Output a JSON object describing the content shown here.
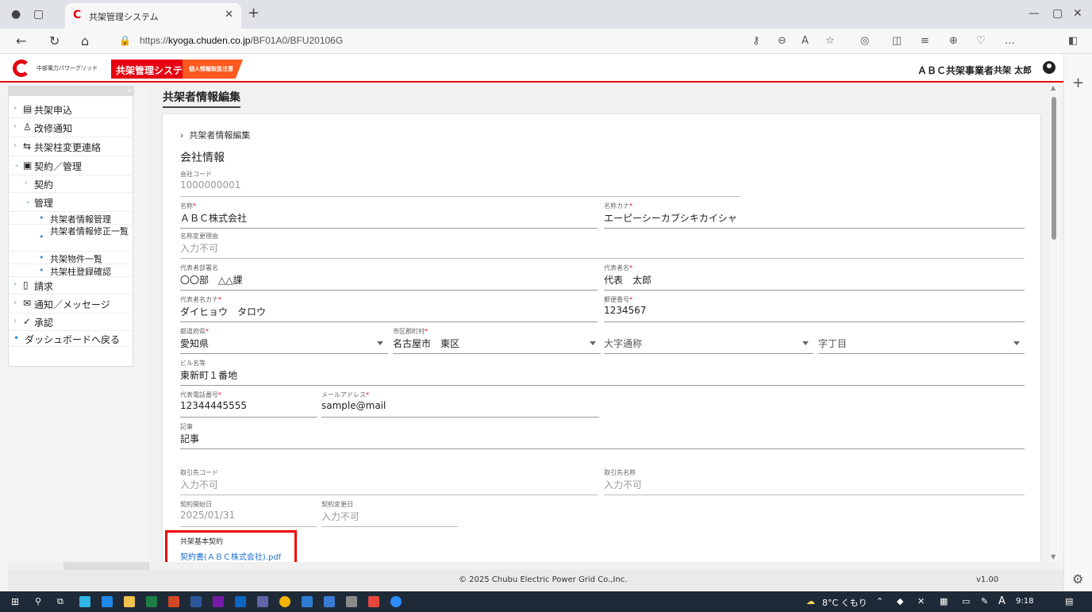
{
  "browser": {
    "tab_title": "共架管理システム",
    "url_prefix": "https://",
    "url_domain": "kyoga.chuden.co.jp",
    "url_path": "/BF01A0/BFU20106G"
  },
  "header": {
    "company_logo_text": "中部電力パワーグリッド",
    "system_name": "共架管理システム",
    "privacy_badge": "個人情報取扱注意",
    "user_company": "ＡＢＣ共架事業者",
    "user_name": "共架 太郎"
  },
  "sidebar": {
    "items": [
      {
        "label": "共架申込",
        "icon": "form-icon"
      },
      {
        "label": "改修通知",
        "icon": "person-icon"
      },
      {
        "label": "共架柱変更連絡",
        "icon": "pole-change-icon"
      },
      {
        "label": "契約／管理",
        "icon": "contract-icon"
      },
      {
        "label": "契約"
      },
      {
        "label": "管理"
      },
      {
        "label": "共架者情報管理"
      },
      {
        "label": "共架者情報修正一覧"
      },
      {
        "label": "共架物件一覧"
      },
      {
        "label": "共架柱登録確認"
      },
      {
        "label": "請求",
        "icon": "invoice-icon"
      },
      {
        "label": "通知／メッセージ",
        "icon": "mail-icon"
      },
      {
        "label": "承認",
        "icon": "check-circle-icon"
      },
      {
        "label": "ダッシュボードへ戻る"
      }
    ]
  },
  "main": {
    "page_title": "共架者情報編集",
    "breadcrumb": "共架者情報編集",
    "section_title": "会社情報",
    "fields": {
      "company_code": {
        "label": "会社コード",
        "value": "1000000001"
      },
      "name": {
        "label": "名称",
        "value": "ＡＢＣ株式会社"
      },
      "name_kana": {
        "label": "名称カナ",
        "value": "エーピーシーカブシキカイシャ"
      },
      "name_change_reason": {
        "label": "名称変更理由",
        "value": "入力不可"
      },
      "rep_dept": {
        "label": "代表者部署名",
        "value": "〇〇部　△△課"
      },
      "rep_name": {
        "label": "代表者名",
        "value": "代表　太郎"
      },
      "rep_kana": {
        "label": "代表者名カナ",
        "value": "ダイヒョウ　タロウ"
      },
      "postal": {
        "label": "郵便番号",
        "value": "1234567"
      },
      "prefecture": {
        "label": "都道府県",
        "value": "愛知県"
      },
      "city": {
        "label": "市区郡町村",
        "value": "名古屋市　東区"
      },
      "oaza": {
        "label": "",
        "value": "大字通称"
      },
      "chome": {
        "label": "",
        "value": "字丁目"
      },
      "building": {
        "label": "ビル名等",
        "value": "東新町１番地"
      },
      "phone": {
        "label": "代表電話番号",
        "value": "12344445555"
      },
      "email": {
        "label": "メールアドレス",
        "value": "sample@mail"
      },
      "note": {
        "label": "記事",
        "value": "記事"
      },
      "partner_code": {
        "label": "取引先コード",
        "value": "入力不可"
      },
      "partner_name": {
        "label": "取引先名称",
        "value": "入力不可"
      },
      "contract_start": {
        "label": "契約開始日",
        "value": "2025/01/31"
      },
      "contract_change": {
        "label": "契約変更日",
        "value": "入力不可"
      }
    },
    "contract": {
      "label": "共架基本契約",
      "link": "契約書(ＡＢＣ株式会社).pdf"
    }
  },
  "footer": {
    "copyright": "© 2025 Chubu Electric Power Grid Co.,Inc.",
    "version": "v1.00"
  },
  "taskbar": {
    "weather": "8°C くもり",
    "ime": "A",
    "time": "9:18"
  },
  "colors": {
    "brand_red": "#e60012",
    "privacy_orange": "#ff5a1f",
    "highlight_red": "#ee0000",
    "link_blue": "#1a6fd1"
  }
}
